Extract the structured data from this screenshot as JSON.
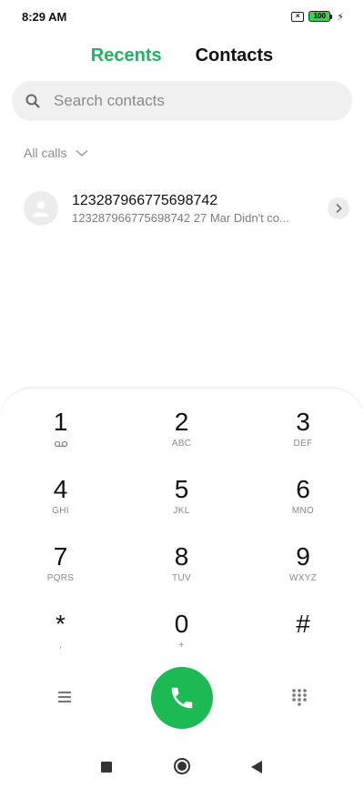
{
  "status_bar": {
    "time": "8:29 AM",
    "battery_level": "100",
    "battery_color": "#3bd14c"
  },
  "tabs": [
    {
      "label": "Recents",
      "active": true
    },
    {
      "label": "Contacts",
      "active": false
    }
  ],
  "accent_color": "#20b462",
  "search": {
    "placeholder": "Search contacts",
    "value": ""
  },
  "filter": {
    "label": "All calls",
    "icon": "chevron-down-icon"
  },
  "recent_calls": [
    {
      "name": "123287966775698742",
      "number": "123287966775698742",
      "date": "27 Mar",
      "status": "Didn't co..."
    }
  ],
  "dialpad": {
    "keys": [
      {
        "digit": "1",
        "letters": "",
        "icon": "voicemail-icon"
      },
      {
        "digit": "2",
        "letters": "ABC"
      },
      {
        "digit": "3",
        "letters": "DEF"
      },
      {
        "digit": "4",
        "letters": "GHI"
      },
      {
        "digit": "5",
        "letters": "JKL"
      },
      {
        "digit": "6",
        "letters": "MNO"
      },
      {
        "digit": "7",
        "letters": "PQRS"
      },
      {
        "digit": "8",
        "letters": "TUV"
      },
      {
        "digit": "9",
        "letters": "WXYZ"
      },
      {
        "digit": "*",
        "letters": ","
      },
      {
        "digit": "0",
        "letters": "+"
      },
      {
        "digit": "#",
        "letters": ""
      }
    ],
    "call_button_color": "#1db954"
  },
  "nav_bar": {
    "buttons": [
      "recents-square-icon",
      "home-circle-icon",
      "back-triangle-icon"
    ]
  }
}
